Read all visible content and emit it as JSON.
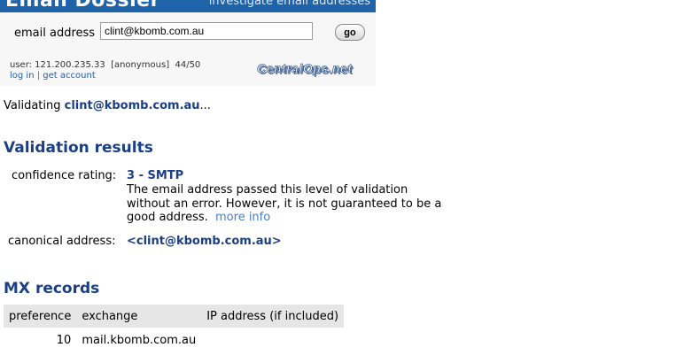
{
  "header": {
    "title": "Email Dossier",
    "tagline": "investigate email addresses",
    "email_label": "email address",
    "email_value": "clint@kbomb.com.au",
    "go_label": "go",
    "user_line": "user: 121.200.235.33  [anonymous]  44/50",
    "login_link": "log in",
    "separator": "|",
    "account_link": "get account",
    "logo_text": "CentralOps.net"
  },
  "validating": {
    "prefix": "Validating ",
    "address": "clint@kbomb.com.au",
    "suffix": "..."
  },
  "validation": {
    "heading": "Validation results",
    "confidence_label": "confidence rating:",
    "confidence_value": "3 - SMTP",
    "confidence_desc": "The email address passed this level of validation without an error. However, it is not guaranteed to be a good address.",
    "more_info": "more info",
    "canonical_label": "canonical address:",
    "canonical_value": "<clint@kbomb.com.au>"
  },
  "mx": {
    "heading": "MX records",
    "columns": [
      "preference",
      "exchange",
      "IP address (if included)"
    ],
    "rows": [
      {
        "preference": "10",
        "exchange": "mail.kbomb.com.au",
        "ip": ""
      }
    ]
  },
  "colors": {
    "banner": "#1f64a8",
    "heading": "#1b3f86",
    "link": "#4a7ec7"
  }
}
